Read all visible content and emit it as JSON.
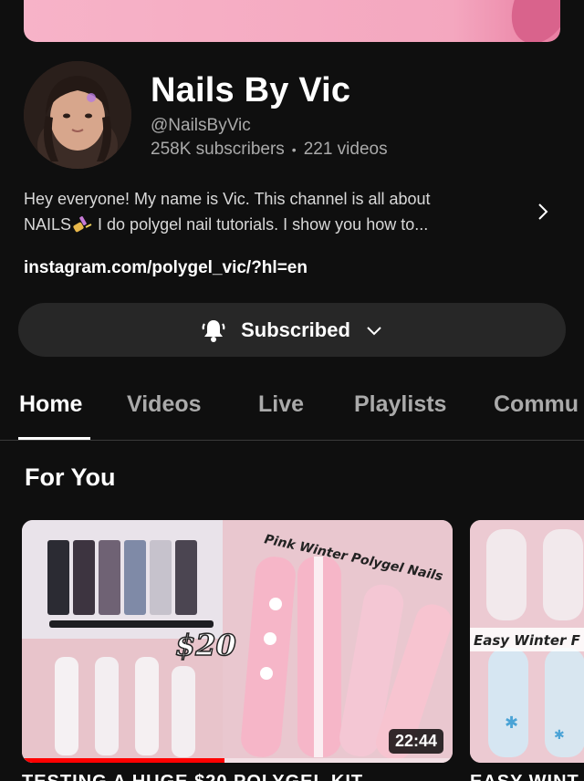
{
  "channel": {
    "name": "Nails By Vic",
    "handle": "@NailsByVic",
    "subscribers": "258K subscribers",
    "separator": "•",
    "videos": "221 videos",
    "about_line1": "Hey everyone! My name is Vic. This channel is all about",
    "about_line2_a": "NAILS",
    "about_line2_b": " I do polygel nail tutorials. I show you how to...",
    "link": "instagram.com/polygel_vic/?hl=en"
  },
  "subscribe": {
    "label": "Subscribed",
    "icon": "bell-ringing-icon"
  },
  "tabs": [
    {
      "label": "Home",
      "active": true
    },
    {
      "label": "Videos",
      "active": false
    },
    {
      "label": "Live",
      "active": false
    },
    {
      "label": "Playlists",
      "active": false
    },
    {
      "label": "Commu",
      "active": false
    }
  ],
  "section": {
    "title": "For You"
  },
  "videos": [
    {
      "thumb_price_text": "$20",
      "thumb_caption": "Pink Winter Polygel Nails",
      "duration": "22:44",
      "progress": 0.47,
      "title": "TESTING A HUGE $20 POLYGEL KIT"
    },
    {
      "thumb_caption": "Easy Winter F",
      "title": "EASY WINT"
    }
  ],
  "colors": {
    "background": "#0f0f0f",
    "surface": "#272727",
    "secondary_text": "#aaaaaa",
    "progress_red": "#ff0000",
    "banner_pink": "#f4a7bf"
  }
}
